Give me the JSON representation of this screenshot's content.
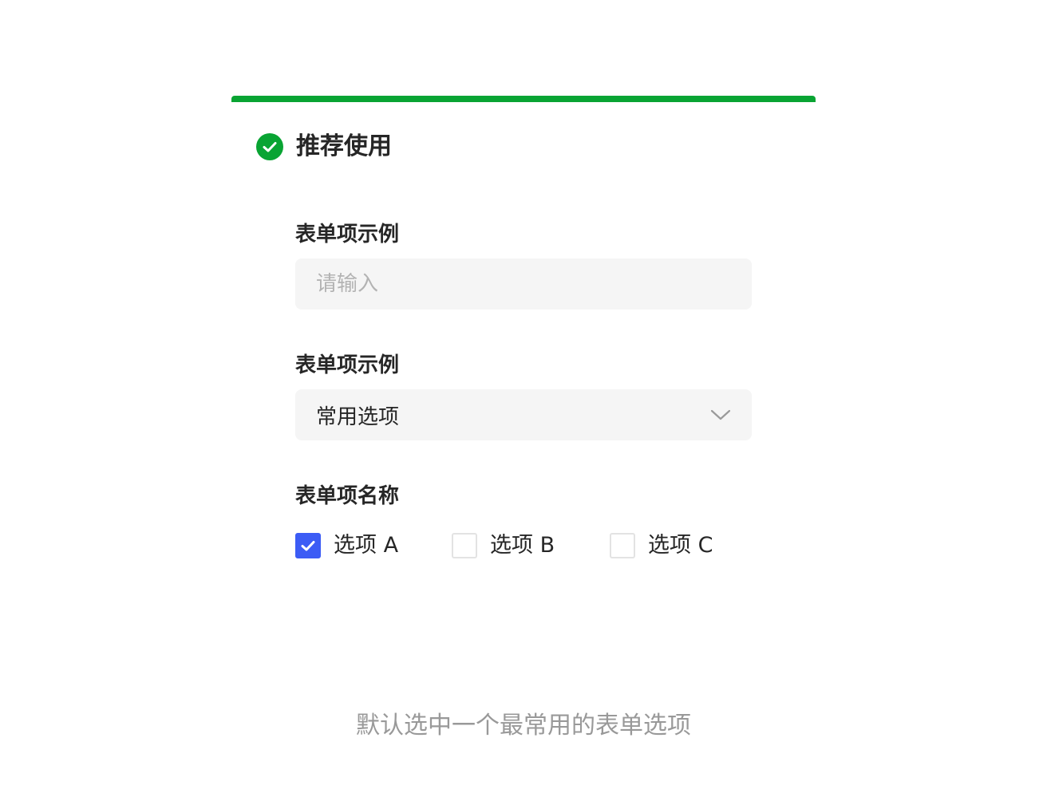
{
  "header": {
    "title": "推荐使用",
    "accent_color": "#09a433",
    "status_icon": "check-circle-icon"
  },
  "form": {
    "text_field": {
      "label": "表单项示例",
      "placeholder": "请输入",
      "value": ""
    },
    "select_field": {
      "label": "表单项示例",
      "value": "常用选项",
      "icon": "chevron-down-icon"
    },
    "checkbox_group": {
      "label": "表单项名称",
      "options": [
        {
          "label": "选项 A",
          "checked": true
        },
        {
          "label": "选项 B",
          "checked": false
        },
        {
          "label": "选项 C",
          "checked": false
        }
      ],
      "checked_color": "#3c5cf5"
    }
  },
  "footer": {
    "note": "默认选中一个最常用的表单选项"
  }
}
